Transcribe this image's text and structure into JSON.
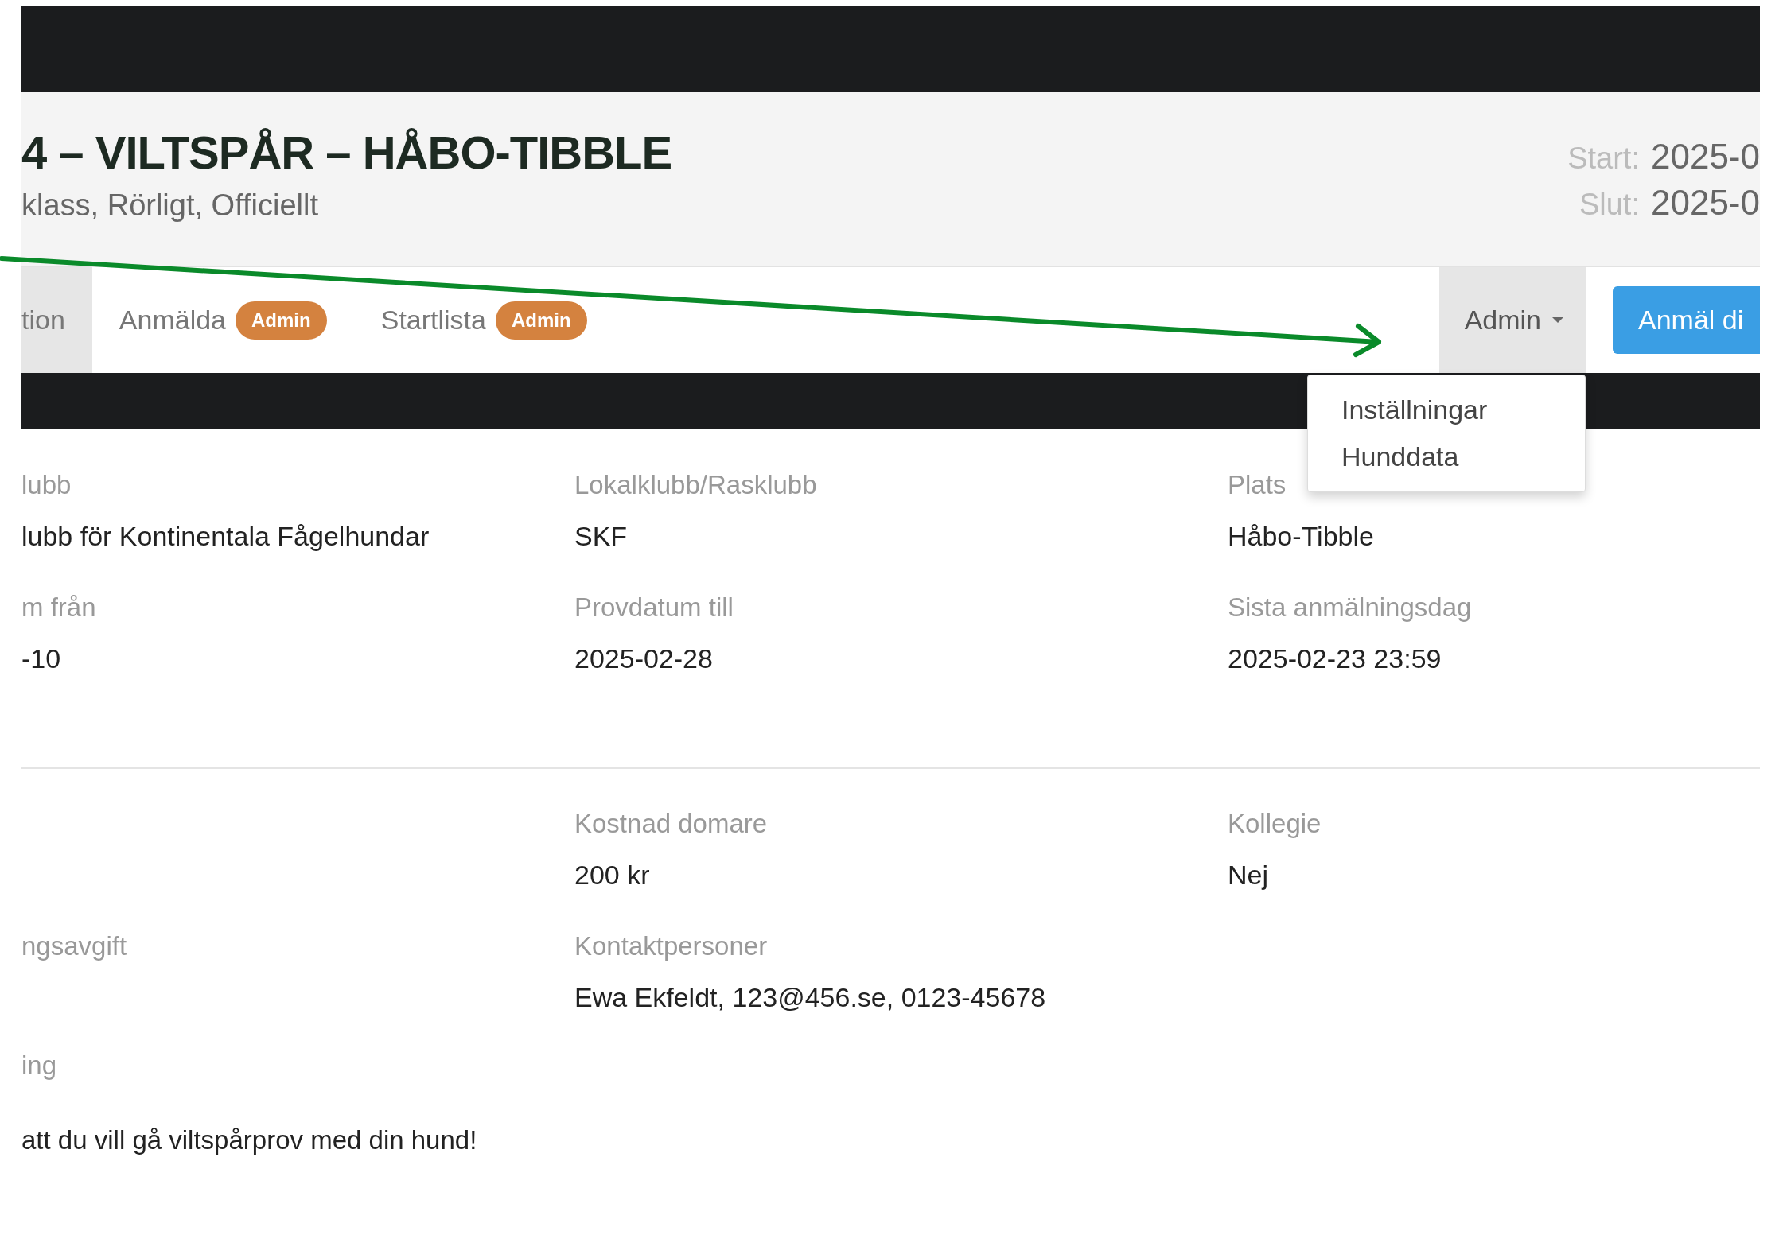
{
  "header": {
    "title": "4 – VILTSPÅR – HÅBO-TIBBLE",
    "subtitle": "klass, Rörligt, Officiellt",
    "dates": [
      {
        "label": "Start:",
        "value": "2025-0"
      },
      {
        "label": "Slut:",
        "value": "2025-0"
      }
    ]
  },
  "nav": {
    "tabs": [
      {
        "label": "tion",
        "selected": true
      },
      {
        "label": "Anmälda",
        "badge": "Admin",
        "selected": false
      },
      {
        "label": "Startlista",
        "badge": "Admin",
        "selected": false
      }
    ],
    "admin_menu": {
      "label": "Admin",
      "expanded": true,
      "items": [
        "Inställningar",
        "Hunddata"
      ]
    },
    "signup_button": "Anmäl di"
  },
  "sections": [
    {
      "rows": [
        [
          {
            "label": "lubb",
            "value": "lubb för Kontinentala Fågelhundar"
          },
          {
            "label": "Lokalklubb/Rasklubb",
            "value": "SKF"
          },
          {
            "label": "Plats",
            "value": "Håbo-Tibble"
          }
        ],
        [
          {
            "label": "m från",
            "value": "-10"
          },
          {
            "label": "Provdatum till",
            "value": "2025-02-28"
          },
          {
            "label": "Sista anmälningsdag",
            "value": "2025-02-23 23:59"
          }
        ]
      ]
    },
    {
      "rows": [
        [
          {},
          {
            "label": "Kostnad domare",
            "value": "200 kr"
          },
          {
            "label": "Kollegie",
            "value": "Nej"
          }
        ],
        [
          {
            "label": "ngsavgift"
          },
          {
            "label": "Kontaktpersoner",
            "value": "Ewa Ekfeldt, 123@456.se, 0123-45678"
          },
          {}
        ]
      ]
    }
  ],
  "description": {
    "label": "ing",
    "text": "att du vill gå viltspårprov med din hund!"
  }
}
